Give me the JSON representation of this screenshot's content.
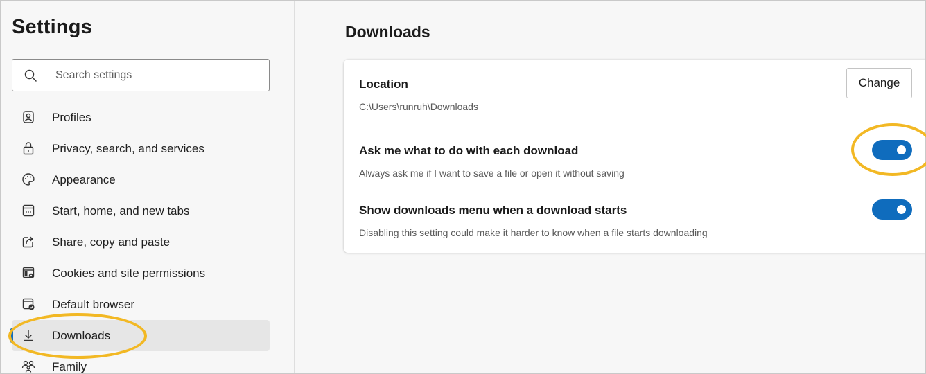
{
  "sidebar": {
    "title": "Settings",
    "search_placeholder": "Search settings",
    "items": [
      {
        "label": "Profiles",
        "icon": "profile-icon"
      },
      {
        "label": "Privacy, search, and services",
        "icon": "lock-icon"
      },
      {
        "label": "Appearance",
        "icon": "palette-icon"
      },
      {
        "label": "Start, home, and new tabs",
        "icon": "start-tab-icon"
      },
      {
        "label": "Share, copy and paste",
        "icon": "share-icon"
      },
      {
        "label": "Cookies and site permissions",
        "icon": "cookies-icon"
      },
      {
        "label": "Default browser",
        "icon": "default-browser-icon"
      },
      {
        "label": "Downloads",
        "icon": "download-icon",
        "active": true
      },
      {
        "label": "Family",
        "icon": "family-icon"
      }
    ]
  },
  "main": {
    "title": "Downloads",
    "location": {
      "title": "Location",
      "path": "C:\\Users\\runruh\\Downloads",
      "button_label": "Change"
    },
    "ask_each": {
      "title": "Ask me what to do with each download",
      "description": "Always ask me if I want to save a file or open it without saving",
      "enabled": true
    },
    "show_menu": {
      "title": "Show downloads menu when a download starts",
      "description": "Disabling this setting could make it harder to know when a file starts downloading",
      "enabled": true
    }
  },
  "colors": {
    "accent": "#0f6cbd",
    "highlight": "#f2b824"
  }
}
